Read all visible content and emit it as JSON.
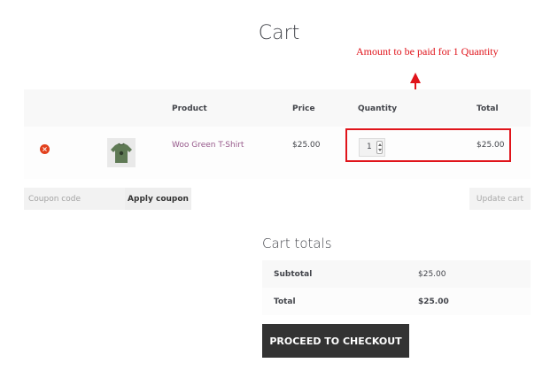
{
  "page": {
    "title": "Cart"
  },
  "annotation": {
    "text": "Amount to be paid for 1 Quantity",
    "color": "#e0141b"
  },
  "cart": {
    "headers": {
      "product": "Product",
      "price": "Price",
      "quantity": "Quantity",
      "total": "Total"
    },
    "items": [
      {
        "name": "Woo Green T-Shirt",
        "price": "$25.00",
        "quantity": "1",
        "total": "$25.00",
        "remove_icon": "remove-circle-icon",
        "thumbnail": "green-t-shirt"
      }
    ],
    "link_color": "#96588a",
    "remove_color": "#e2401c"
  },
  "coupon": {
    "placeholder": "Coupon code",
    "apply_label": "Apply coupon"
  },
  "update": {
    "label": "Update cart"
  },
  "totals": {
    "title": "Cart totals",
    "subtotal_label": "Subtotal",
    "subtotal_value": "$25.00",
    "total_label": "Total",
    "total_value": "$25.00"
  },
  "checkout": {
    "label": "PROCEED TO CHECKOUT",
    "bg_color": "#333333"
  }
}
